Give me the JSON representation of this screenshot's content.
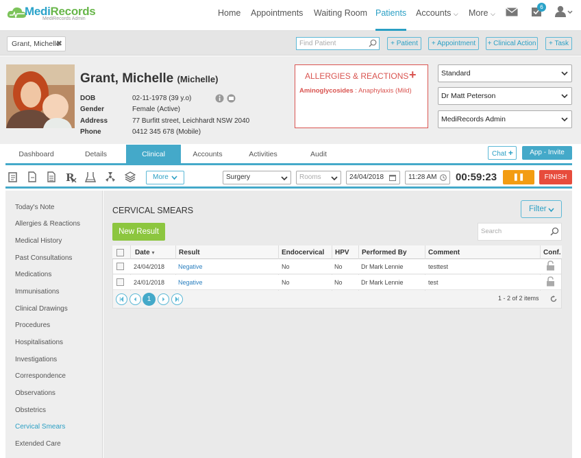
{
  "app": {
    "logo_text_1": "Medi",
    "logo_text_2": "Records",
    "logo_sub": "MediRecords Admin",
    "nav": [
      {
        "label": "Home"
      },
      {
        "label": "Appointments"
      },
      {
        "label": "Waiting Room"
      },
      {
        "label": "Patients"
      },
      {
        "label": "Accounts"
      },
      {
        "label": "More"
      }
    ],
    "tasks_badge": "6"
  },
  "toolbar": {
    "patient_tab": "Grant, Michelle",
    "find_placeholder": "Find Patient",
    "btn_patient": "+ Patient",
    "btn_appointment": "+ Appointment",
    "btn_clinical_action": "+ Clinical Action",
    "btn_task": "+ Task"
  },
  "patient": {
    "name": "Grant, Michelle",
    "preferred": "(Michelle)",
    "dob_label": "DOB",
    "dob": "02-11-1978 (39 y.o)",
    "gender_label": "Gender",
    "gender": "Female (Active)",
    "address_label": "Address",
    "address": "77 Burfitt street, Leichhardt NSW 2040",
    "phone_label": "Phone",
    "phone": "0412 345 678 (Mobile)"
  },
  "allergies": {
    "title": "ALLERGIES & REACTIONS",
    "plus": "+",
    "item_name": "Aminoglycosides",
    "item_sep": " : ",
    "item_reaction": "Anaphylaxis (Mild)"
  },
  "selects": {
    "billing": "Standard",
    "doctor": "Dr Matt Peterson",
    "user": "MediRecords Admin"
  },
  "tabs": [
    {
      "label": "Dashboard"
    },
    {
      "label": "Details"
    },
    {
      "label": "Clinical"
    },
    {
      "label": "Accounts"
    },
    {
      "label": "Activities"
    },
    {
      "label": "Audit"
    }
  ],
  "header_actions": {
    "chat": "Chat",
    "app_invite": "App - Invite"
  },
  "clinical_toolbar": {
    "more": "More",
    "location": "Surgery",
    "rooms_placeholder": "Rooms",
    "date": "24/04/2018",
    "time": "11:28 AM",
    "timer": "00:59:23",
    "pause": "❚❚",
    "finish": "FINISH"
  },
  "left_menu": [
    {
      "label": "Today's Note"
    },
    {
      "label": "Allergies & Reactions"
    },
    {
      "label": "Medical History"
    },
    {
      "label": "Past Consultations"
    },
    {
      "label": "Medications"
    },
    {
      "label": "Immunisations"
    },
    {
      "label": "Clinical Drawings"
    },
    {
      "label": "Procedures"
    },
    {
      "label": "Hospitalisations"
    },
    {
      "label": "Investigations"
    },
    {
      "label": "Correspondence"
    },
    {
      "label": "Observations"
    },
    {
      "label": "Obstetrics"
    },
    {
      "label": "Cervical Smears"
    },
    {
      "label": "Extended Care"
    }
  ],
  "section": {
    "title": "CERVICAL SMEARS",
    "filter": "Filter",
    "new_result": "New Result",
    "search_placeholder": "Search"
  },
  "grid": {
    "columns": [
      "Date",
      "Result",
      "Endocervical",
      "HPV",
      "Performed By",
      "Comment",
      "Conf."
    ],
    "sort_indicator": "▾",
    "rows": [
      {
        "date": "24/04/2018",
        "result": "Negative",
        "endo": "No",
        "hpv": "No",
        "by": "Dr Mark Lennie",
        "comment": "testtest"
      },
      {
        "date": "24/01/2018",
        "result": "Negative",
        "endo": "No",
        "hpv": "No",
        "by": "Dr Mark Lennie",
        "comment": "test"
      }
    ],
    "page": "1",
    "summary": "1 - 2 of 2 items"
  },
  "colors": {
    "accent": "#44a9c9",
    "green": "#8cc63f",
    "orange": "#f39c12",
    "red": "#e74c3c"
  }
}
